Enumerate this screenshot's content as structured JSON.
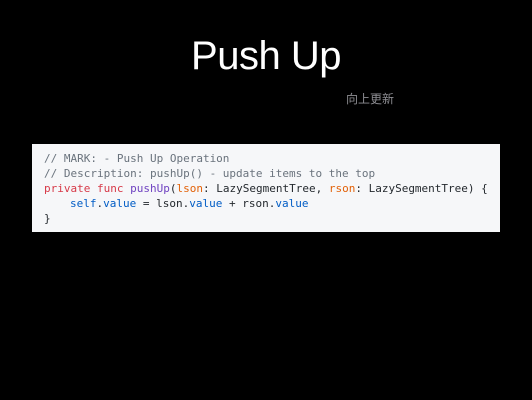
{
  "slide": {
    "title": "Push Up",
    "subtitle": "向上更新"
  },
  "code": {
    "line1": "// MARK: - Push Up Operation",
    "line2": "// Description: pushUp() - update items to the top",
    "line3": {
      "kw_private": "private",
      "kw_func": "func",
      "func_name": "pushUp",
      "open_paren": "(",
      "param1": "lson",
      "colon1": ": ",
      "type1": "LazySegmentTree",
      "comma": ", ",
      "param2": "rson",
      "colon2": ": ",
      "type2": "LazySegmentTree",
      "close": ") {"
    },
    "line4": {
      "kw_self": "self",
      "dot1": ".",
      "prop1": "value",
      "assign": " = lson.",
      "prop2": "value",
      "plus": " + rson.",
      "prop3": "value"
    },
    "line5": "}"
  },
  "colors": {
    "background": "#000000",
    "title": "#ffffff",
    "subtitle": "#8e8e93",
    "code_background": "#f6f7f9",
    "comment": "#6a737d",
    "keyword": "#d73a49",
    "function": "#6f42c1",
    "parameter": "#e36209",
    "property": "#005cc5"
  }
}
